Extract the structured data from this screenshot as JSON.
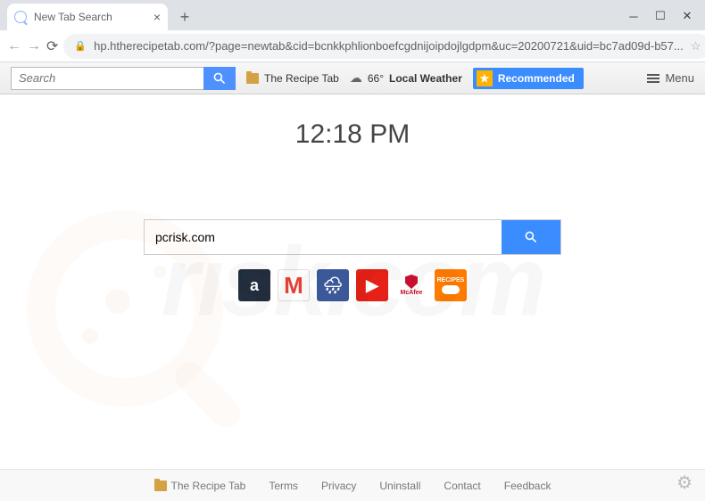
{
  "browser": {
    "tab_title": "New Tab Search",
    "url": "hp.htherecipetab.com/?page=newtab&cid=bcnkkphlionboefcgdnijoipdojlgdpm&uc=20200721&uid=bc7ad09d-b57..."
  },
  "toolbar": {
    "search_placeholder": "Search",
    "recipe_tab": "The Recipe Tab",
    "weather_temp": "66°",
    "weather_label": "Local Weather",
    "recommended": "Recommended",
    "menu": "Menu"
  },
  "main": {
    "clock": "12:18 PM",
    "search_value": "pcrisk.com",
    "tiles": {
      "amazon": "a",
      "gmail": "M",
      "mcafee": "McAfee",
      "recipes": "RECIPES"
    }
  },
  "footer": {
    "recipe_tab": "The Recipe Tab",
    "terms": "Terms",
    "privacy": "Privacy",
    "uninstall": "Uninstall",
    "contact": "Contact",
    "feedback": "Feedback"
  },
  "watermark": "rısk.com"
}
